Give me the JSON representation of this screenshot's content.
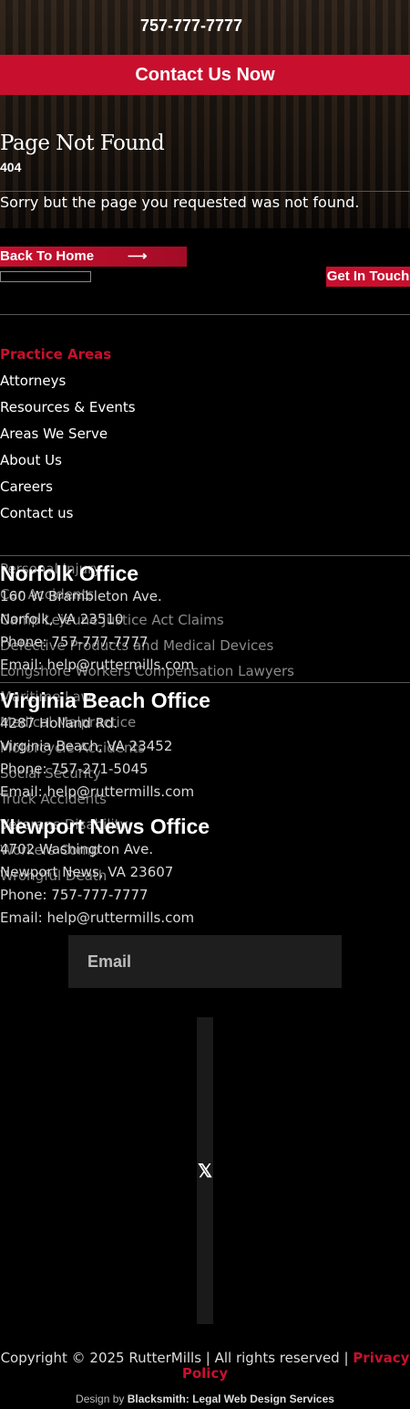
{
  "header": {
    "phone": "757-777-7777",
    "contact_button": "Contact Us Now"
  },
  "error": {
    "title": "Page Not Found",
    "code": "404",
    "message": "Sorry but the page you requested was not found.",
    "back_button": "Back To Home",
    "back_arrow_icon": "arrow-right-icon"
  },
  "cta": {
    "get_in_touch": "Get In Touch"
  },
  "nav": {
    "items": [
      {
        "label": "Practice Areas"
      },
      {
        "label": "Attorneys"
      },
      {
        "label": "Resources & Events"
      },
      {
        "label": "Areas We Serve"
      },
      {
        "label": "About Us"
      },
      {
        "label": "Careers"
      },
      {
        "label": "Contact us"
      }
    ]
  },
  "practice_areas": {
    "items": [
      {
        "label": "Personal Injury"
      },
      {
        "label": "Car Accidents"
      },
      {
        "label": "Camp Lejeune Justice Act Claims"
      },
      {
        "label": "Defective Products and Medical Devices"
      },
      {
        "label": "Longshore Workers Compensation Lawyers"
      },
      {
        "label": "Maritime Law"
      },
      {
        "label": "Medical Malpractice"
      },
      {
        "label": "Motorcycle Accidents"
      },
      {
        "label": "Social Security"
      },
      {
        "label": "Truck Accidents"
      },
      {
        "label": "Veterans Disability"
      },
      {
        "label": "Workers Comp"
      },
      {
        "label": "Wrongful Death"
      }
    ]
  },
  "offices": [
    {
      "name": "Norfolk Office",
      "street": "160 W Brambleton Ave.",
      "city": "Norfolk, VA 23510",
      "phone": "Phone: 757-777-7777",
      "email": "Email: help@ruttermills.com"
    },
    {
      "name": "Virginia Beach Office",
      "street": "4287 Holland Rd.",
      "city": "Virginia Beach, VA 23452",
      "phone": "Phone: 757-271-5045",
      "email": "Email: help@ruttermills.com"
    },
    {
      "name": "Newport News Office",
      "street": "4702 Washington Ave.",
      "city": "Newport News, VA 23607",
      "phone": "Phone: 757-777-7777",
      "email": "Email: help@ruttermills.com"
    }
  ],
  "newsletter": {
    "email_placeholder": "Email"
  },
  "social": {
    "icon": "x-twitter-icon",
    "glyph": "𝕏"
  },
  "footer": {
    "copyright": "Copyright © 2025 RutterMills | All rights reserved | ",
    "privacy": "Privacy Policy",
    "design_by": "Design by ",
    "designer": "Blacksmith: Legal Web Design Services"
  },
  "colors": {
    "accent": "#c8102e",
    "background": "#000000"
  }
}
